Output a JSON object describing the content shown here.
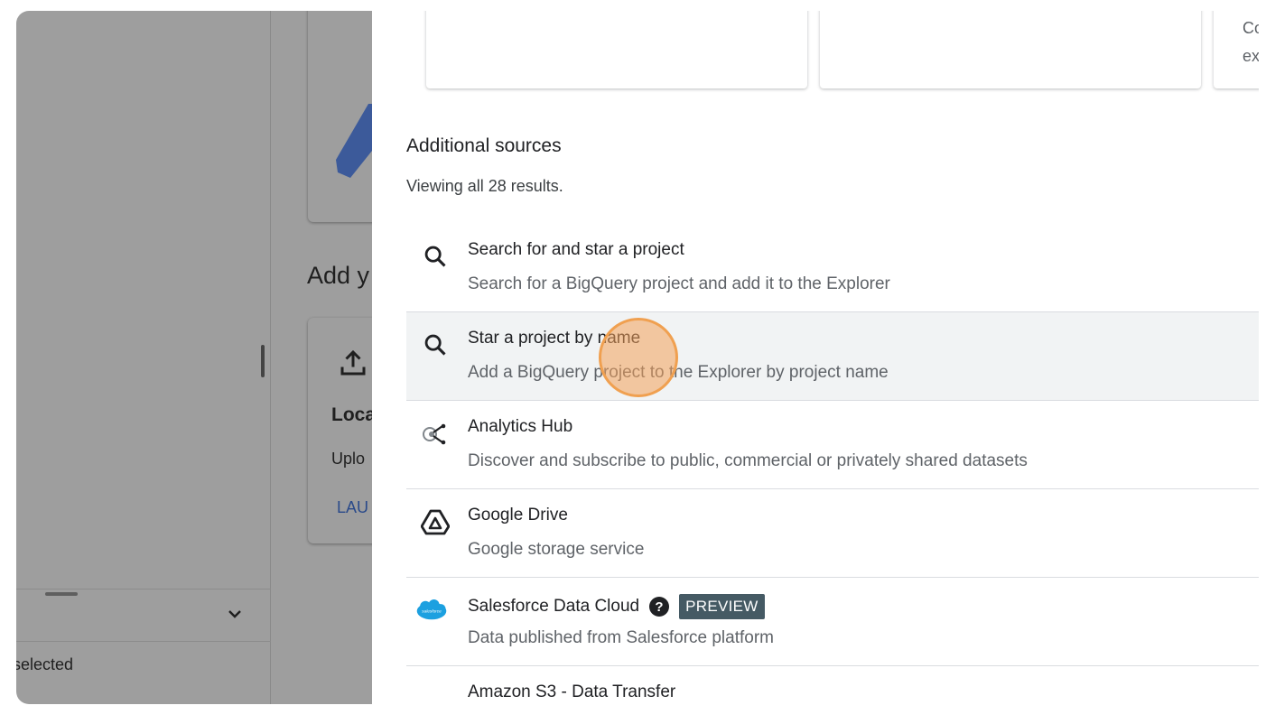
{
  "background": {
    "add_heading": "Add y",
    "local_card": {
      "title": "Loca",
      "description": "Uplo",
      "launch_link": "LAU"
    },
    "selected_text": "selected"
  },
  "top_cards": [
    {
      "text_line1": "",
      "text_line2": ""
    },
    {
      "text_line1": "",
      "text_line2": ""
    },
    {
      "text_line1": "Co",
      "text_line2": "ex"
    }
  ],
  "additional_sources": {
    "title": "Additional sources",
    "results_text": "Viewing all 28 results.",
    "items": [
      {
        "title": "Search for and star a project",
        "description": "Search for a BigQuery project and add it to the Explorer",
        "icon": "search-icon"
      },
      {
        "title": "Star a project by name",
        "description": "Add a BigQuery project to the Explorer by project name",
        "icon": "search-icon"
      },
      {
        "title": "Analytics Hub",
        "description": "Discover and subscribe to public, commercial or privately shared datasets",
        "icon": "analytics-hub-icon"
      },
      {
        "title": "Google Drive",
        "description": "Google storage service",
        "icon": "google-drive-icon"
      },
      {
        "title": "Salesforce Data Cloud",
        "description": "Data published from Salesforce platform",
        "icon": "salesforce-icon",
        "badge": "PREVIEW"
      },
      {
        "title": "Amazon S3 - Data Transfer",
        "description": "",
        "icon": ""
      }
    ]
  },
  "colors": {
    "badge_bg": "#455a64",
    "hover_row": "#f1f3f4",
    "cursor_highlight": "#f0a050"
  }
}
